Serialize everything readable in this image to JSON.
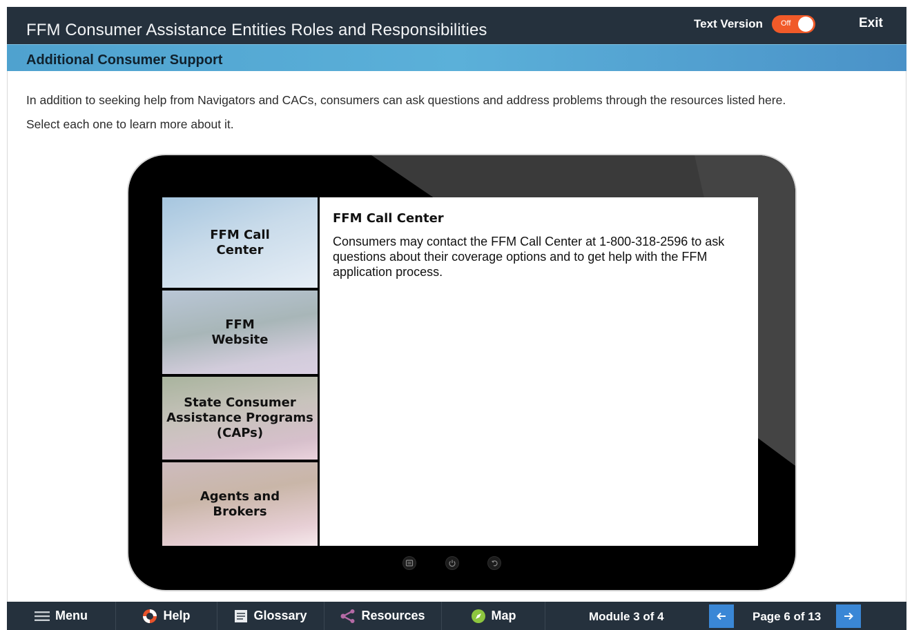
{
  "header": {
    "title": "FFM Consumer Assistance Entities Roles and Responsibilities",
    "text_version_label": "Text Version",
    "toggle_state": "Off",
    "exit_label": "Exit"
  },
  "section": {
    "title": "Additional Consumer Support"
  },
  "intro": {
    "line1": "In addition to seeking help from Navigators and CACs, consumers can ask questions and address problems through the resources listed here.",
    "line2": "Select each one to learn more about it."
  },
  "tabs": [
    {
      "label": "FFM Call\nCenter"
    },
    {
      "label": "FFM\nWebsite"
    },
    {
      "label": "State Consumer\nAssistance Programs\n(CAPs)"
    },
    {
      "label": "Agents and\nBrokers"
    }
  ],
  "content": {
    "title": "FFM Call Center",
    "body": "Consumers may contact the FFM Call Center at 1-800-318-2596 to ask questions about their coverage options and to get help with the FFM application process."
  },
  "footer": {
    "menu": "Menu",
    "help": "Help",
    "glossary": "Glossary",
    "resources": "Resources",
    "map": "Map",
    "module": "Module 3 of 4",
    "page": "Page 6 of 13"
  },
  "icons": {
    "menu": "hamburger-icon",
    "help": "lifebuoy-icon",
    "glossary": "book-icon",
    "resources": "share-icon",
    "map": "compass-icon",
    "prev": "arrow-left-icon",
    "next": "arrow-right-icon"
  },
  "colors": {
    "header_bg": "#25313d",
    "subbar_bg": "#4fa2cf",
    "toggle": "#f15a29",
    "nav_arrow": "#3a87d6"
  }
}
